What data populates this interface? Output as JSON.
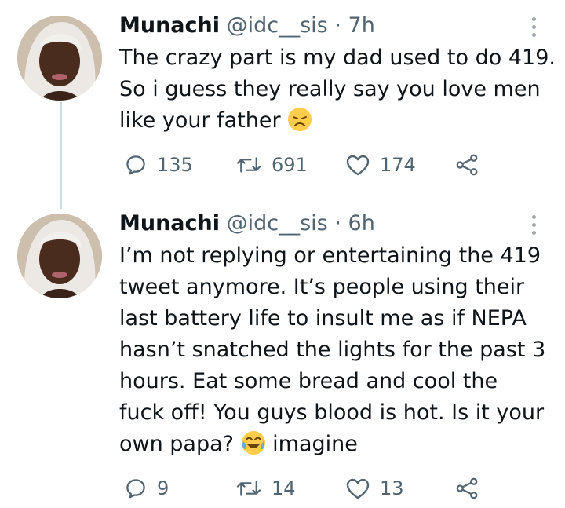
{
  "tweets": [
    {
      "name": "Munachi",
      "handle": "@idc__sis",
      "separator": "·",
      "time": "7h",
      "text": "The crazy part is my dad used to do 419.\nSo i guess they really say you love men\nlike your father ",
      "emoji": "disappointed-face",
      "replies": "135",
      "retweets": "691",
      "likes": "174"
    },
    {
      "name": "Munachi",
      "handle": "@idc__sis",
      "separator": "·",
      "time": "6h",
      "text": "I’m not replying or entertaining the 419\ntweet anymore. It’s people using their\nlast battery life to insult me as if NEPA\nhasn’t snatched the lights for the past 3\nhours. Eat some bread and cool the\nfuck off! You guys blood is hot. Is it your\nown papa? ",
      "emoji": "tears-of-joy-face",
      "text_after_emoji": " imagine",
      "replies": "9",
      "retweets": "14",
      "likes": "13"
    }
  ],
  "icons": {
    "reply": "reply-icon",
    "retweet": "retweet-icon",
    "like": "heart-icon",
    "share": "share-icon",
    "more": "more-options-icon"
  },
  "colors": {
    "text": "#0f1419",
    "secondary": "#536471",
    "thread_line": "#cfd9de"
  }
}
